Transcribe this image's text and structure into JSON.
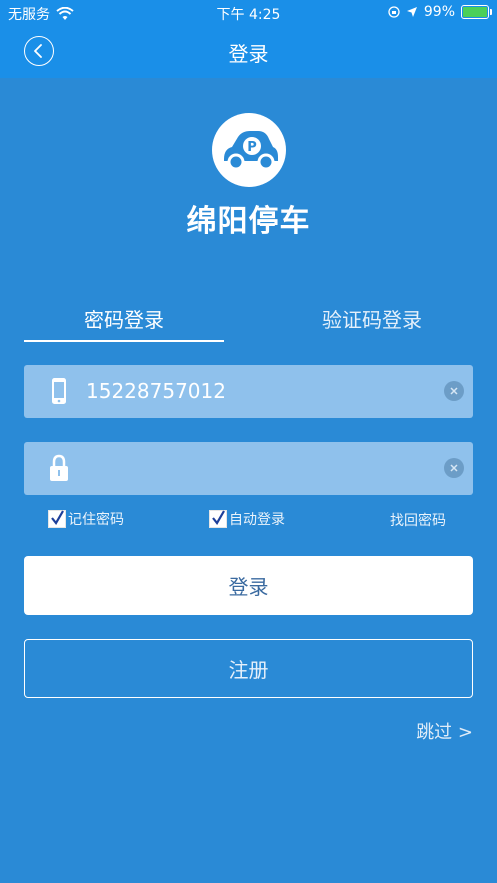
{
  "status_bar": {
    "carrier": "无服务",
    "time": "下午 4:25",
    "battery_percent": "99%",
    "battery_level": 0.99,
    "icons": [
      "wifi-icon",
      "lock-rotation-icon",
      "location-arrow-icon",
      "battery-icon"
    ]
  },
  "nav": {
    "title": "登录",
    "back_icon": "chevron-left-icon"
  },
  "brand": {
    "name": "绵阳停车",
    "logo_icon": "parking-car-icon"
  },
  "tabs": [
    {
      "label": "密码登录",
      "active": true
    },
    {
      "label": "验证码登录",
      "active": false
    }
  ],
  "form": {
    "phone_value": "15228757012",
    "phone_icon": "phone-icon",
    "password_value": "",
    "password_icon": "lock-icon",
    "clear_icon": "clear-icon"
  },
  "options": {
    "remember_label": "记住密码",
    "remember_checked": true,
    "auto_label": "自动登录",
    "auto_checked": true,
    "forgot_label": "找回密码"
  },
  "buttons": {
    "login_label": "登录",
    "register_label": "注册",
    "skip_label": "跳过 >"
  },
  "colors": {
    "background": "#2a8ad6",
    "bar": "#1a8fe8",
    "field": "#8fc1ec",
    "check": "#1e3f9a"
  }
}
